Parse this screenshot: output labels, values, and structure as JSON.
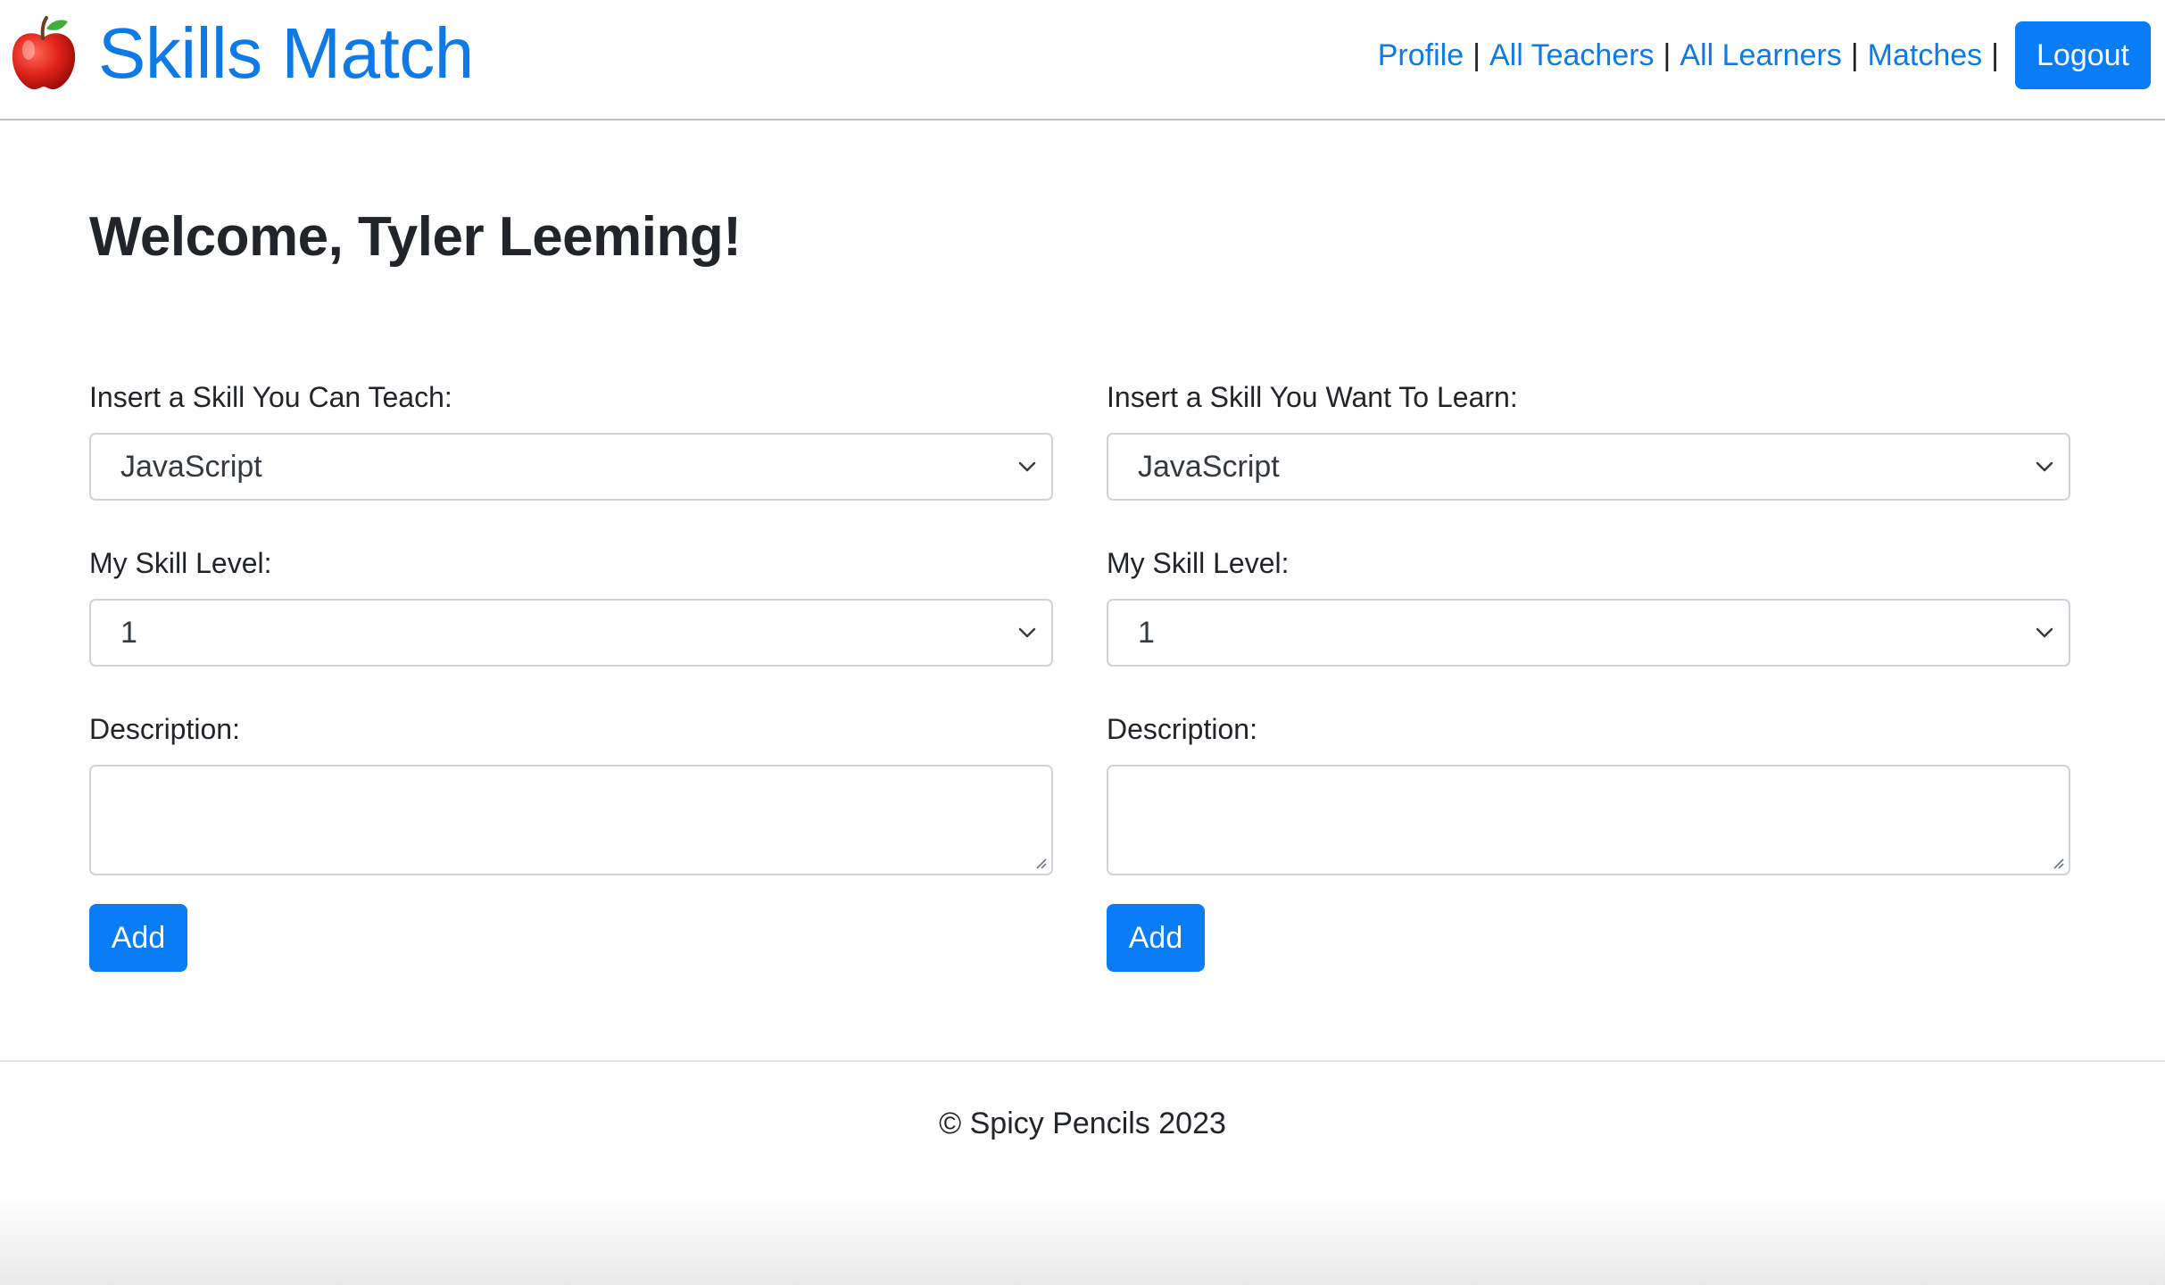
{
  "header": {
    "brand_title": "Skills Match",
    "brand_icon": "apple-icon",
    "nav": {
      "profile": "Profile",
      "all_teachers": "All Teachers",
      "all_learners": "All Learners",
      "matches": "Matches",
      "separator": "|",
      "logout": "Logout"
    }
  },
  "main": {
    "welcome": "Welcome, Tyler Leeming!",
    "teach": {
      "skill_label": "Insert a Skill You Can Teach:",
      "skill_value": "JavaScript",
      "level_label": "My Skill Level:",
      "level_value": "1",
      "description_label": "Description:",
      "description_value": "",
      "add_label": "Add"
    },
    "learn": {
      "skill_label": "Insert a Skill You Want To Learn:",
      "skill_value": "JavaScript",
      "level_label": "My Skill Level:",
      "level_value": "1",
      "description_label": "Description:",
      "description_value": "",
      "add_label": "Add"
    }
  },
  "footer": {
    "copyright": "© Spicy Pencils 2023"
  },
  "colors": {
    "brand_blue": "#0d7ae8",
    "button_blue": "#0a7cf5",
    "text": "#212529",
    "border": "#ced4da"
  }
}
